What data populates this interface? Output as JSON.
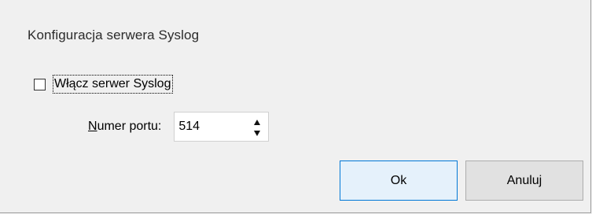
{
  "dialog": {
    "title": "Konfiguracja serwera Syslog",
    "enable_checkbox": {
      "label": "Włącz serwer Syslog",
      "checked": false
    },
    "port": {
      "label_mnemonic": "N",
      "label_rest": "umer portu:",
      "value": "514"
    },
    "buttons": {
      "ok_label": "Ok",
      "cancel_label": "Anuluj"
    }
  },
  "icons": {
    "spin_up": "spin-up-icon",
    "spin_down": "spin-down-icon"
  },
  "colors": {
    "background": "#f0f0f0",
    "ok_button_bg": "#e5f1fb",
    "ok_button_border": "#0078d7",
    "cancel_button_bg": "#e1e1e1"
  }
}
